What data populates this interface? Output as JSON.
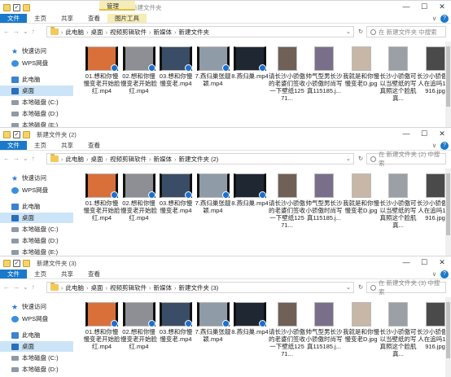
{
  "windows": [
    {
      "title": "新建文件夹",
      "context_tab_group": "管理",
      "tabs": [
        "文件",
        "主页",
        "共享",
        "查看",
        "图片工具"
      ],
      "path": [
        "此电脑",
        "桌面",
        "视频剪辑软件",
        "新媒体",
        "新建文件夹"
      ],
      "search_placeholder": "在 新建文件夹 中搜索",
      "nav": [
        {
          "label": "快速访问",
          "icon": "star-icon"
        },
        {
          "label": "WPS网盘",
          "icon": "wps-cloud-icon"
        },
        {
          "label": "此电脑",
          "icon": "this-pc-icon"
        },
        {
          "label": "桌面",
          "icon": "desktop-icon"
        },
        {
          "label": "本地磁盘 (C:)",
          "icon": "drive-icon"
        },
        {
          "label": "本地磁盘 (D:)",
          "icon": "drive-icon"
        },
        {
          "label": "本地磁盘 (E:)",
          "icon": "drive-icon"
        }
      ],
      "selected_nav": "桌面"
    },
    {
      "title": "新建文件夹 (2)",
      "tabs": [
        "文件",
        "主页",
        "共享",
        "查看"
      ],
      "path": [
        "此电脑",
        "桌面",
        "视频剪辑软件",
        "新媒体",
        "新建文件夹 (2)"
      ],
      "search_placeholder": "在 新建文件夹 (2) 中搜索",
      "nav": [
        {
          "label": "快速访问",
          "icon": "star-icon"
        },
        {
          "label": "WPS网盘",
          "icon": "wps-cloud-icon"
        },
        {
          "label": "此电脑",
          "icon": "this-pc-icon"
        },
        {
          "label": "桌面",
          "icon": "desktop-icon"
        },
        {
          "label": "本地磁盘 (C:)",
          "icon": "drive-icon"
        },
        {
          "label": "本地磁盘 (D:)",
          "icon": "drive-icon"
        },
        {
          "label": "本地磁盘 (E:)",
          "icon": "drive-icon"
        }
      ],
      "selected_nav": "桌面"
    },
    {
      "title": "新建文件夹 (3)",
      "tabs": [
        "文件",
        "主页",
        "共享",
        "查看"
      ],
      "path": [
        "此电脑",
        "桌面",
        "视频剪辑软件",
        "新媒体",
        "新建文件夹 (3)"
      ],
      "search_placeholder": "在 新建文件夹 (3) 中搜索",
      "nav": [
        {
          "label": "快速访问",
          "icon": "star-icon"
        },
        {
          "label": "WPS网盘",
          "icon": "wps-cloud-icon"
        },
        {
          "label": "此电脑",
          "icon": "this-pc-icon"
        },
        {
          "label": "桌面",
          "icon": "desktop-icon"
        },
        {
          "label": "本地磁盘 (C:)",
          "icon": "drive-icon"
        },
        {
          "label": "本地磁盘 (D:)",
          "icon": "drive-icon"
        }
      ],
      "selected_nav": "桌面"
    }
  ],
  "files": [
    {
      "name": "01.想和你慢慢变老开始脸红.mp4",
      "type": "video",
      "color": "#d9703a"
    },
    {
      "name": "02.想和你慢慢变老开始脸红.mp4",
      "type": "video",
      "color": "#8d8f94"
    },
    {
      "name": "03.想和你慢慢变老.mp4",
      "type": "video",
      "color": "#3a4d66"
    },
    {
      "name": "7.燕归巢张靓颖.mp4",
      "type": "video",
      "color": "#8f9ba6"
    },
    {
      "name": "8.燕归巢.mp4",
      "type": "video",
      "color": "#1f2733"
    },
    {
      "name": "请长沙小骄傲的老婆们签收一下壁纸12571...",
      "type": "image",
      "color": "#6f6058"
    },
    {
      "name": "帅气型男长沙小骄傲时尚写真115185.j...",
      "type": "image",
      "color": "#7a6f8a"
    },
    {
      "name": "我就是和你慢慢变老D.jpg",
      "type": "image",
      "color": "#c8b7a6"
    },
    {
      "name": "长沙小骄傲可以当壁纸的写真照这个脸肌真...",
      "type": "image",
      "color": "#9aa0a5"
    },
    {
      "name": "长沙小骄傲有人在追吗120916.jpg",
      "type": "image",
      "color": "#4a4a4a"
    }
  ],
  "icons": {
    "up": "↑",
    "back": "←",
    "forward": "→",
    "dropdown": "⌄",
    "refresh": "↻",
    "minimize": "—",
    "maximize": "☐",
    "close": "✕",
    "expand_ribbon": "∨",
    "help": "?"
  },
  "colors": {
    "file_tab": "#1979ca",
    "selection": "#cce4f7",
    "folder": "#f4c95b"
  }
}
